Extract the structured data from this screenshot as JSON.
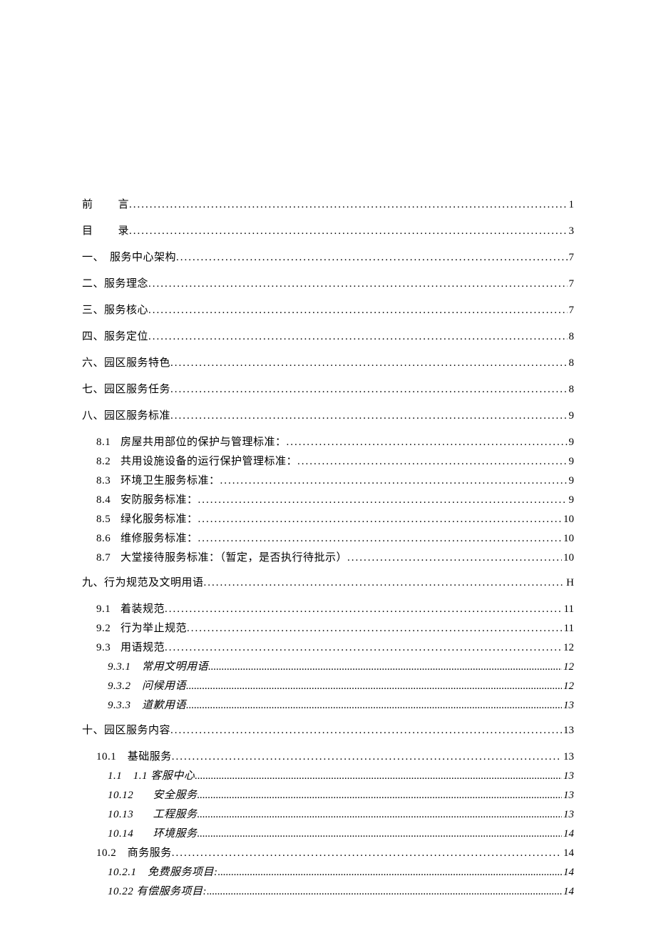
{
  "toc": {
    "lines": [
      {
        "level": 0,
        "label_html": "前<span class='sp-wide'>　</span>言",
        "page": "1"
      },
      {
        "level": 0,
        "label_html": "目<span class='sp-wide'>　</span>录",
        "page": "3"
      },
      {
        "level": 0,
        "label_html": "一、　服务中心架构",
        "page": "7"
      },
      {
        "level": 0,
        "label_html": "二、服务理念 ",
        "page": "7"
      },
      {
        "level": 0,
        "label_html": "三、服务核心 ",
        "page": "7"
      },
      {
        "level": 0,
        "label_html": "四、服务定位 ",
        "page": "8"
      },
      {
        "level": 0,
        "label_html": "六、园区服务特色 ",
        "page": "8"
      },
      {
        "level": 0,
        "label_html": "七、园区服务任务 ",
        "page": "8"
      },
      {
        "level": 0,
        "label_html": "八、园区服务标准 ",
        "page": "9"
      },
      {
        "level": 1,
        "label_html": "<span class='num-col'>8.1</span>房屋共用部位的保护与管理标准： ",
        "page": "9",
        "gap_before": true
      },
      {
        "level": 1,
        "label_html": "<span class='num-col'>8.2</span>共用设施设备的运行保护管理标准： ",
        "page": "9"
      },
      {
        "level": 1,
        "label_html": "<span class='num-col'>8.3</span>环境卫生服务标准： ",
        "page": "9"
      },
      {
        "level": 1,
        "label_html": "<span class='num-col'>8.4</span>安防服务标准： ",
        "page": "9"
      },
      {
        "level": 1,
        "label_html": "<span class='num-col'>8.5</span>绿化服务标准： ",
        "page": "10"
      },
      {
        "level": 1,
        "label_html": "<span class='num-col'>8.6</span>维修服务标准： ",
        "page": "10"
      },
      {
        "level": 1,
        "label_html": "<span class='num-col'>8.7</span>大堂接待服务标准：（暂定，是否执行待批示） ",
        "page": "10"
      },
      {
        "level": 0,
        "label_html": "九、行为规范及文明用语 ",
        "page": "H",
        "gap_before": true
      },
      {
        "level": 1,
        "label_html": "<span class='num-col'>9.1</span>着装规范 ",
        "page": "11",
        "gap_before": true
      },
      {
        "level": 1,
        "label_html": "<span class='num-col'>9.2</span>行为举止规范 ",
        "page": "11"
      },
      {
        "level": 1,
        "label_html": "<span class='num-col'>9.3</span>用语规范 ",
        "page": "12"
      },
      {
        "level": 2,
        "label_html": "<span class='num-col2'>9.3.1</span>常用文明用语 ",
        "page": "12"
      },
      {
        "level": 2,
        "label_html": "<span class='num-col2'>9.3.2</span>问候用语 ",
        "page": "12"
      },
      {
        "level": 2,
        "label_html": "<span class='num-col2'>9.3.3</span>道歉用语 ",
        "page": "13"
      },
      {
        "level": 0,
        "label_html": "十、园区服务内容 ",
        "page": "13",
        "gap_before": true
      },
      {
        "level": 1,
        "label_html": "10.1　基础服务 ",
        "page": "13",
        "gap_before": true
      },
      {
        "level": 2,
        "label_html": "1.1　1.1 客服中心",
        "page": "13"
      },
      {
        "level": 2,
        "label_html": "<span class='num-col2'>10.12</span>　安全服务",
        "page": "13"
      },
      {
        "level": 2,
        "label_html": "<span class='num-col2'>10.13</span>　工程服务",
        "page": "13"
      },
      {
        "level": 2,
        "label_html": "<span class='num-col2'>10.14</span>　环境服务",
        "page": "14"
      },
      {
        "level": 1,
        "label_html": "10.2　商务服务 ",
        "page": "14"
      },
      {
        "level": 2,
        "label_html": "10.2.1　免费服务项目: ",
        "page": "14"
      },
      {
        "level": 2,
        "label_html": "10.22 有偿服务项目: ",
        "page": "14"
      }
    ]
  }
}
